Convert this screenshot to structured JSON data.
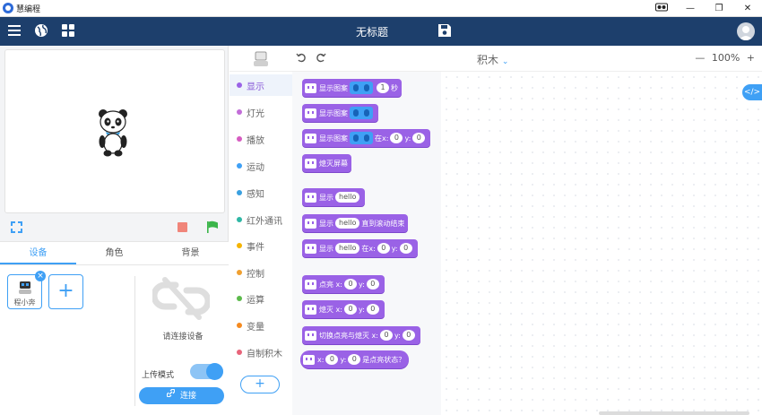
{
  "window": {
    "app_name": "慧编程",
    "minimize": "—",
    "restore": "❐",
    "close": "✕"
  },
  "toolbar": {
    "doc_title": "无标题"
  },
  "stage": {
    "tabs": [
      {
        "label": "设备",
        "active": true
      },
      {
        "label": "角色",
        "active": false
      },
      {
        "label": "背景",
        "active": false
      }
    ],
    "device": {
      "label": "程小奔"
    },
    "add_device": "+",
    "connect_hint": "请连接设备",
    "upload_mode_label": "上传模式",
    "upload_mode_on": true,
    "connect_label": "连接"
  },
  "categories": [
    {
      "label": "显示",
      "color": "#9a62e6",
      "active": true
    },
    {
      "label": "灯光",
      "color": "#c26dd8",
      "active": false
    },
    {
      "label": "播放",
      "color": "#d65cc1",
      "active": false
    },
    {
      "label": "运动",
      "color": "#3fa0f5",
      "active": false
    },
    {
      "label": "感知",
      "color": "#3aa0e0",
      "active": false
    },
    {
      "label": "红外通讯",
      "color": "#2fb7a5",
      "active": false
    },
    {
      "label": "事件",
      "color": "#f5b400",
      "active": false
    },
    {
      "label": "控制",
      "color": "#f0a030",
      "active": false
    },
    {
      "label": "运算",
      "color": "#5cba4b",
      "active": false
    },
    {
      "label": "变量",
      "color": "#f58a1f",
      "active": false
    },
    {
      "label": "自制积木",
      "color": "#e8647a",
      "active": false
    }
  ],
  "add_extension": "+",
  "workspace": {
    "mode": "积木",
    "zoom": "100%",
    "zoom_out": "—",
    "zoom_in": "+",
    "code_toggle": "</>"
  },
  "blocks": {
    "b1": {
      "t1": "显示图案",
      "n1": "1",
      "t2": "秒"
    },
    "b2": {
      "t1": "显示图案"
    },
    "b3": {
      "t1": "显示图案",
      "t2": "在x:",
      "n1": "0",
      "t3": "y:",
      "n2": "0"
    },
    "b4": {
      "t1": "熄灭屏幕"
    },
    "b5": {
      "t1": "显示",
      "p1": "hello"
    },
    "b6": {
      "t1": "显示",
      "p1": "hello",
      "t2": "直到滚动结束"
    },
    "b7": {
      "t1": "显示",
      "p1": "hello",
      "t2": "在x:",
      "n1": "0",
      "t3": "y:",
      "n2": "0"
    },
    "b8": {
      "t1": "点亮 x:",
      "n1": "0",
      "t2": "y:",
      "n2": "0"
    },
    "b9": {
      "t1": "熄灭 x:",
      "n1": "0",
      "t2": "y:",
      "n2": "0"
    },
    "b10": {
      "t1": "切换点亮与熄灭 x:",
      "n1": "0",
      "t2": "y:",
      "n2": "0"
    },
    "b11": {
      "t1": "x:",
      "n1": "0",
      "t2": "y:",
      "n2": "0",
      "t3": "是点亮状态？"
    }
  }
}
